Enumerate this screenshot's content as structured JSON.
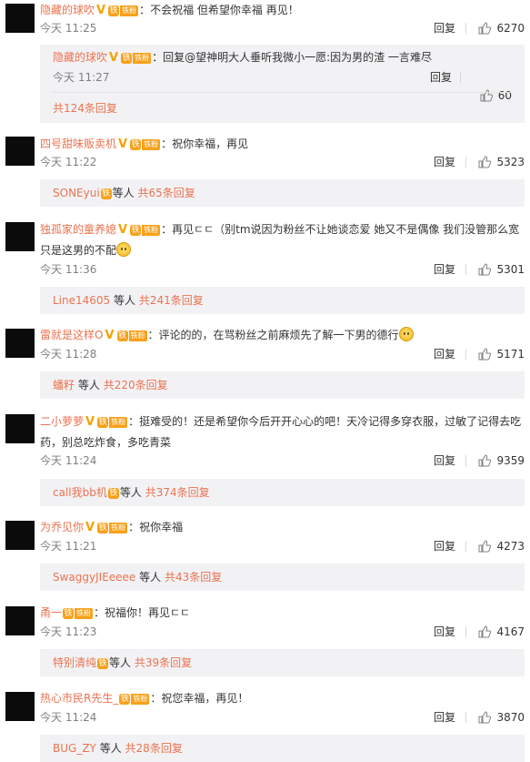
{
  "labels": {
    "reply": "回复",
    "fan_badge": "铁粉",
    "v_mark": "V",
    "fan_icon": "铁"
  },
  "comments": [
    {
      "user": "隐藏的球吹",
      "text": "：不会祝福 但希望你幸福 再见！",
      "time": "今天 11:25",
      "likes": "6270",
      "nested": {
        "user": "隐藏的球吹",
        "text": "：回复@望神明大人垂听我微小一愿:因为男的渣 一言难尽",
        "time": "今天 11:27",
        "likes": "60"
      },
      "more": "共124条回复"
    },
    {
      "user": "四号甜味贩卖机",
      "text": "：祝你幸福，再见",
      "time": "今天 11:22",
      "likes": "5323",
      "replier": "SONEyui",
      "suffix": "等人",
      "count": "共65条回复"
    },
    {
      "user": "独孤家的童养媳",
      "text": "：再见ㄷㄷ（别tm说因为粉丝不让她谈恋爱 她又不是偶像 我们没管那么宽 只是这男的不配",
      "time": "今天 11:36",
      "likes": "5301",
      "replier": "Line14605",
      "suffix": "等人",
      "count": "共241条回复"
    },
    {
      "user": "雷就是这样O",
      "text": "：评论的的，在骂粉丝之前麻烦先了解一下男的德行",
      "time": "今天 11:28",
      "likes": "5171",
      "replier": "蟠籽",
      "suffix": "等人",
      "count": "共220条回复"
    },
    {
      "user": "二小萝萝",
      "text": "：挺难受的！还是希望你今后开开心心的吧！天冷记得多穿衣服，过敏了记得去吃药，别总吃炸食，多吃青菜",
      "time": "今天 11:24",
      "likes": "9359",
      "replier": "call我bb机",
      "suffix": "等人",
      "count": "共374条回复"
    },
    {
      "user": "为乔见你",
      "text": "：祝你幸福",
      "time": "今天 11:21",
      "likes": "4273",
      "replier": "SwaggyJIEeeee",
      "suffix": "等人",
      "count": "共43条回复"
    },
    {
      "user": "甬一",
      "text": "：祝福你！再见ㄷㄷ",
      "time": "今天 11:23",
      "likes": "4167",
      "replier": "特别清纯",
      "suffix": "等人",
      "count": "共39条回复"
    },
    {
      "user": "热心市民R先生_",
      "text": "：祝您幸福，再见！",
      "time": "今天 11:24",
      "likes": "3870",
      "replier": "BUG_ZY",
      "suffix": "等人",
      "count": "共28条回复"
    }
  ]
}
